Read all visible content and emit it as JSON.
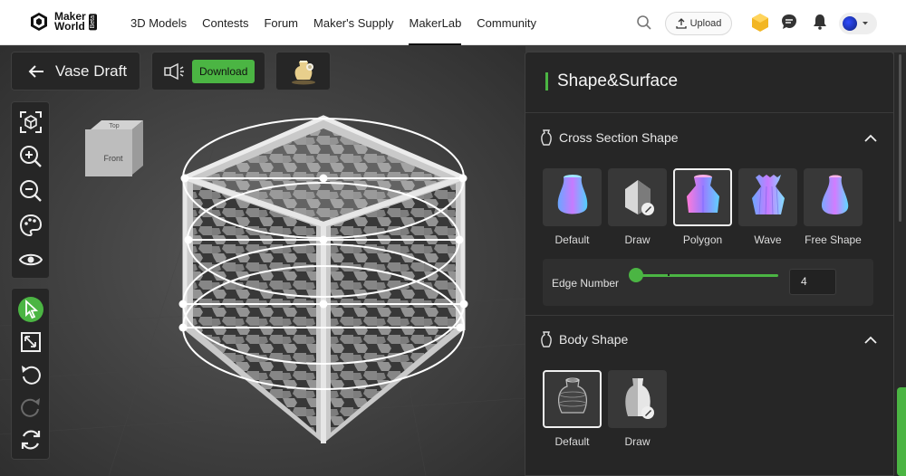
{
  "header": {
    "logo_line1": "Maker",
    "logo_line2": "World",
    "logo_badge": "Beta",
    "nav": [
      "3D Models",
      "Contests",
      "Forum",
      "Maker's Supply",
      "MakerLab",
      "Community"
    ],
    "active_nav": "MakerLab",
    "upload_label": "Upload",
    "icons": [
      "search-icon",
      "upload-icon",
      "points-icon",
      "chat-icon",
      "bell-icon",
      "avatar",
      "chevron-down-icon"
    ]
  },
  "toolbar": {
    "back_label": "Vase Draft",
    "download_label": "Download"
  },
  "viewcube": {
    "top_label": "Top",
    "front_label": "Front"
  },
  "tools_view": [
    "fit-view-icon",
    "zoom-in-icon",
    "zoom-out-icon",
    "palette-icon",
    "eye-icon"
  ],
  "tools_edit": [
    "select-icon",
    "scale-icon",
    "undo-icon",
    "redo-icon",
    "reset-icon"
  ],
  "settings": {
    "title": "Shape&Surface",
    "cross_section": {
      "heading": "Cross Section Shape",
      "options": [
        "Default",
        "Draw",
        "Polygon",
        "Wave",
        "Free Shape"
      ],
      "selected": "Polygon",
      "edge_label": "Edge Number",
      "edge_value": "4",
      "slider_fraction": 0.0
    },
    "body_shape": {
      "heading": "Body Shape",
      "options": [
        "Default",
        "Draw"
      ],
      "selected": "Default"
    }
  },
  "colors": {
    "accent": "#4bb543",
    "panel": "#262626",
    "viewport": "#3a3a3a"
  }
}
